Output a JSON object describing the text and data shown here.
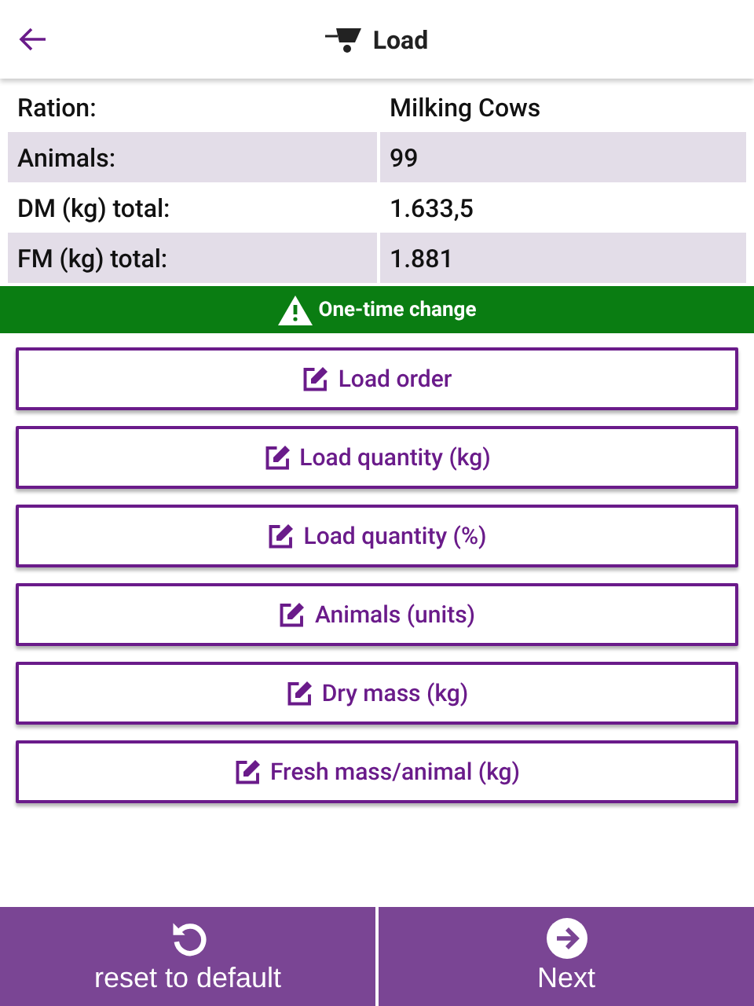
{
  "header": {
    "title": "Load"
  },
  "summary": [
    {
      "label": "Ration:",
      "value": "Milking Cows"
    },
    {
      "label": "Animals:",
      "value": "99"
    },
    {
      "label": "DM (kg) total:",
      "value": "1.633,5"
    },
    {
      "label": "FM (kg) total:",
      "value": "1.881"
    }
  ],
  "banner": {
    "text": "One-time change"
  },
  "options": [
    "Load order",
    "Load quantity (kg)",
    "Load quantity (%)",
    "Animals (units)",
    "Dry mass (kg)",
    "Fresh mass/animal (kg)"
  ],
  "footer": [
    {
      "kind": "reset",
      "label": "reset to default"
    },
    {
      "kind": "next",
      "label": "Next"
    }
  ]
}
